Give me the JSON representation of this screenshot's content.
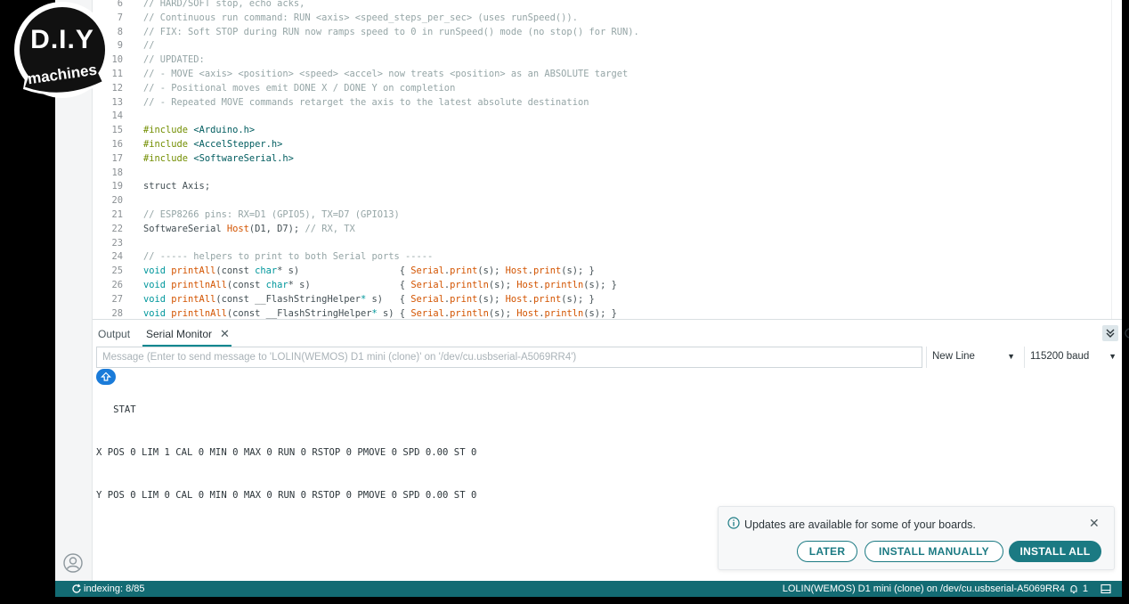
{
  "editor": {
    "lines": [
      {
        "n": "6",
        "segs": [
          {
            "t": "// HARD/SOFT stop, echo acks,",
            "c": "c-comment"
          }
        ]
      },
      {
        "n": "7",
        "segs": [
          {
            "t": "// Continuous run command: RUN <axis> <speed_steps_per_sec> (uses runSpeed()).",
            "c": "c-comment"
          }
        ]
      },
      {
        "n": "8",
        "segs": [
          {
            "t": "// FIX: Soft STOP during RUN now ramps speed to 0 in runSpeed() mode (no stop() for RUN).",
            "c": "c-comment"
          }
        ]
      },
      {
        "n": "9",
        "segs": [
          {
            "t": "//",
            "c": "c-comment"
          }
        ]
      },
      {
        "n": "10",
        "segs": [
          {
            "t": "// UPDATED:",
            "c": "c-comment"
          }
        ]
      },
      {
        "n": "11",
        "segs": [
          {
            "t": "// - MOVE <axis> <position> <speed> <accel> now treats <position> as an ABSOLUTE target",
            "c": "c-comment"
          }
        ]
      },
      {
        "n": "12",
        "segs": [
          {
            "t": "// - Positional moves emit DONE X / DONE Y on completion",
            "c": "c-comment"
          }
        ]
      },
      {
        "n": "13",
        "segs": [
          {
            "t": "// - Repeated MOVE commands retarget the axis to the latest absolute destination",
            "c": "c-comment"
          }
        ]
      },
      {
        "n": "14",
        "segs": []
      },
      {
        "n": "15",
        "segs": [
          {
            "t": "#include ",
            "c": "c-pre"
          },
          {
            "t": "<Arduino.h>",
            "c": "c-str"
          }
        ]
      },
      {
        "n": "16",
        "segs": [
          {
            "t": "#include ",
            "c": "c-pre"
          },
          {
            "t": "<AccelStepper.h>",
            "c": "c-str"
          }
        ]
      },
      {
        "n": "17",
        "segs": [
          {
            "t": "#include ",
            "c": "c-pre"
          },
          {
            "t": "<SoftwareSerial.h>",
            "c": "c-str"
          }
        ]
      },
      {
        "n": "18",
        "segs": []
      },
      {
        "n": "19",
        "segs": [
          {
            "t": "struct Axis;",
            "c": ""
          }
        ]
      },
      {
        "n": "20",
        "segs": []
      },
      {
        "n": "21",
        "segs": [
          {
            "t": "// ESP8266 pins: RX=D1 (GPIO5), TX=D7 (GPIO13)",
            "c": "c-comment"
          }
        ]
      },
      {
        "n": "22",
        "segs": [
          {
            "t": "SoftwareSerial ",
            "c": ""
          },
          {
            "t": "Host",
            "c": "c-fn"
          },
          {
            "t": "(D1, D7); ",
            "c": ""
          },
          {
            "t": "// RX, TX",
            "c": "c-comment"
          }
        ]
      },
      {
        "n": "23",
        "segs": []
      },
      {
        "n": "24",
        "segs": [
          {
            "t": "// ----- helpers to print to both Serial ports -----",
            "c": "c-comment"
          }
        ]
      },
      {
        "n": "25",
        "segs": [
          {
            "t": "void ",
            "c": "c-kw"
          },
          {
            "t": "printAll",
            "c": "c-fn"
          },
          {
            "t": "(const ",
            "c": ""
          },
          {
            "t": "char",
            "c": "c-kw"
          },
          {
            "t": "* s)                  { ",
            "c": ""
          },
          {
            "t": "Serial",
            "c": "c-fn"
          },
          {
            "t": ".",
            "c": ""
          },
          {
            "t": "print",
            "c": "c-fn"
          },
          {
            "t": "(s); ",
            "c": ""
          },
          {
            "t": "Host",
            "c": "c-fn"
          },
          {
            "t": ".",
            "c": ""
          },
          {
            "t": "print",
            "c": "c-fn"
          },
          {
            "t": "(s); }",
            "c": ""
          }
        ]
      },
      {
        "n": "26",
        "segs": [
          {
            "t": "void ",
            "c": "c-kw"
          },
          {
            "t": "printlnAll",
            "c": "c-fn"
          },
          {
            "t": "(const ",
            "c": ""
          },
          {
            "t": "char",
            "c": "c-kw"
          },
          {
            "t": "* s)                { ",
            "c": ""
          },
          {
            "t": "Serial",
            "c": "c-fn"
          },
          {
            "t": ".",
            "c": ""
          },
          {
            "t": "println",
            "c": "c-fn"
          },
          {
            "t": "(s); ",
            "c": ""
          },
          {
            "t": "Host",
            "c": "c-fn"
          },
          {
            "t": ".",
            "c": ""
          },
          {
            "t": "println",
            "c": "c-fn"
          },
          {
            "t": "(s); }",
            "c": ""
          }
        ]
      },
      {
        "n": "27",
        "segs": [
          {
            "t": "void ",
            "c": "c-kw"
          },
          {
            "t": "printAll",
            "c": "c-fn"
          },
          {
            "t": "(const __FlashStringHelper",
            "c": ""
          },
          {
            "t": "*",
            "c": "c-kw"
          },
          {
            "t": " s)   { ",
            "c": ""
          },
          {
            "t": "Serial",
            "c": "c-fn"
          },
          {
            "t": ".",
            "c": ""
          },
          {
            "t": "print",
            "c": "c-fn"
          },
          {
            "t": "(s); ",
            "c": ""
          },
          {
            "t": "Host",
            "c": "c-fn"
          },
          {
            "t": ".",
            "c": ""
          },
          {
            "t": "print",
            "c": "c-fn"
          },
          {
            "t": "(s); }",
            "c": ""
          }
        ]
      },
      {
        "n": "28",
        "segs": [
          {
            "t": "void ",
            "c": "c-kw"
          },
          {
            "t": "printlnAll",
            "c": "c-fn"
          },
          {
            "t": "(const __FlashStringHelper",
            "c": ""
          },
          {
            "t": "*",
            "c": "c-kw"
          },
          {
            "t": " s) { ",
            "c": ""
          },
          {
            "t": "Serial",
            "c": "c-fn"
          },
          {
            "t": ".",
            "c": ""
          },
          {
            "t": "println",
            "c": "c-fn"
          },
          {
            "t": "(s); ",
            "c": ""
          },
          {
            "t": "Host",
            "c": "c-fn"
          },
          {
            "t": ".",
            "c": ""
          },
          {
            "t": "println",
            "c": "c-fn"
          },
          {
            "t": "(s); }",
            "c": ""
          }
        ]
      }
    ]
  },
  "panel": {
    "tabs": {
      "output": "Output",
      "serial": "Serial Monitor",
      "close": "✕"
    },
    "message_placeholder": "Message (Enter to send message to 'LOLIN(WEMOS) D1 mini (clone)' on '/dev/cu.usbserial-A5069RR4')",
    "line_ending": "New Line",
    "baud": "115200 baud",
    "serial_lines": [
      "   STAT",
      "X POS 0 LIM 1 CAL 0 MIN 0 MAX 0 RUN 0 RSTOP 0 PMOVE 0 SPD 0.00 ST 0",
      "Y POS 0 LIM 0 CAL 0 MIN 0 MAX 0 RUN 0 RSTOP 0 PMOVE 0 SPD 0.00 ST 0"
    ]
  },
  "notification": {
    "text": "Updates are available for some of your boards.",
    "close": "✕",
    "later": "LATER",
    "install_manually": "INSTALL MANUALLY",
    "install_all": "INSTALL ALL"
  },
  "statusbar": {
    "indexing": "indexing: 8/85",
    "board": "LOLIN(WEMOS) D1 mini (clone) on /dev/cu.usbserial-A5069RR4",
    "notif_count": "1"
  },
  "logo": {
    "top": "D.I.Y",
    "bottom": "machines"
  },
  "colors": {
    "accent": "#136b73",
    "button": "#1b7a83",
    "badge": "#1a7bd9"
  }
}
